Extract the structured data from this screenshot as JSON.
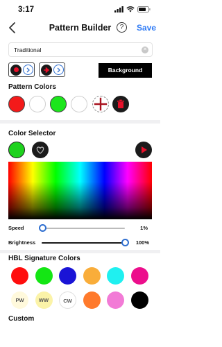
{
  "status": {
    "time": "3:17"
  },
  "nav": {
    "title": "Pattern Builder",
    "help": "?",
    "save": "Save"
  },
  "name_field": {
    "value": "Traditional"
  },
  "background_button": "Background",
  "pattern_colors": {
    "title": "Pattern Colors",
    "swatches": [
      "#f31a1a",
      "#ffffff",
      "#1ce61c",
      "#ffffff"
    ]
  },
  "color_selector": {
    "title": "Color Selector"
  },
  "speed": {
    "label": "Speed",
    "value": "1%",
    "fraction": 0.01
  },
  "brightness": {
    "label": "Brightness",
    "value": "100%",
    "fraction": 1.0
  },
  "signature": {
    "title": "HBL Signature Colors",
    "row1": [
      "#ff0d0d",
      "#14e614",
      "#1a14d6",
      "#f9ad3a",
      "#1ff0f0",
      "#ec0e8c"
    ],
    "row2": [
      {
        "label": "PW",
        "color": "#fff9dc"
      },
      {
        "label": "WW",
        "color": "#fbf3a8"
      },
      {
        "label": "CW",
        "color": "#ffffff"
      },
      {
        "label": "",
        "color": "#ff7a2c"
      },
      {
        "label": "",
        "color": "#f27bd6"
      },
      {
        "label": "",
        "color": "#000000"
      }
    ]
  },
  "custom": {
    "title": "Custom"
  }
}
